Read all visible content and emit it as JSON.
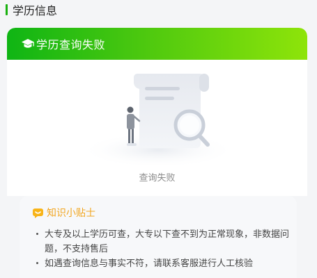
{
  "section": {
    "title": "学历信息"
  },
  "card": {
    "header_title": "学历查询失败",
    "header_icon": "graduation-cap-icon",
    "status_text": "查询失败",
    "colors": {
      "gradient_start": "#0fb514",
      "gradient_end": "#8ee40a"
    }
  },
  "tips": {
    "title": "知识小贴士",
    "icon": "chat-bubble-icon",
    "items": [
      "大专及以上学历可查，大专以下查不到为正常现象，非数据问题，不支持售后",
      "如遇查询信息与事实不符，请联系客服进行人工核验"
    ],
    "colors": {
      "title": "#f2a620"
    }
  }
}
